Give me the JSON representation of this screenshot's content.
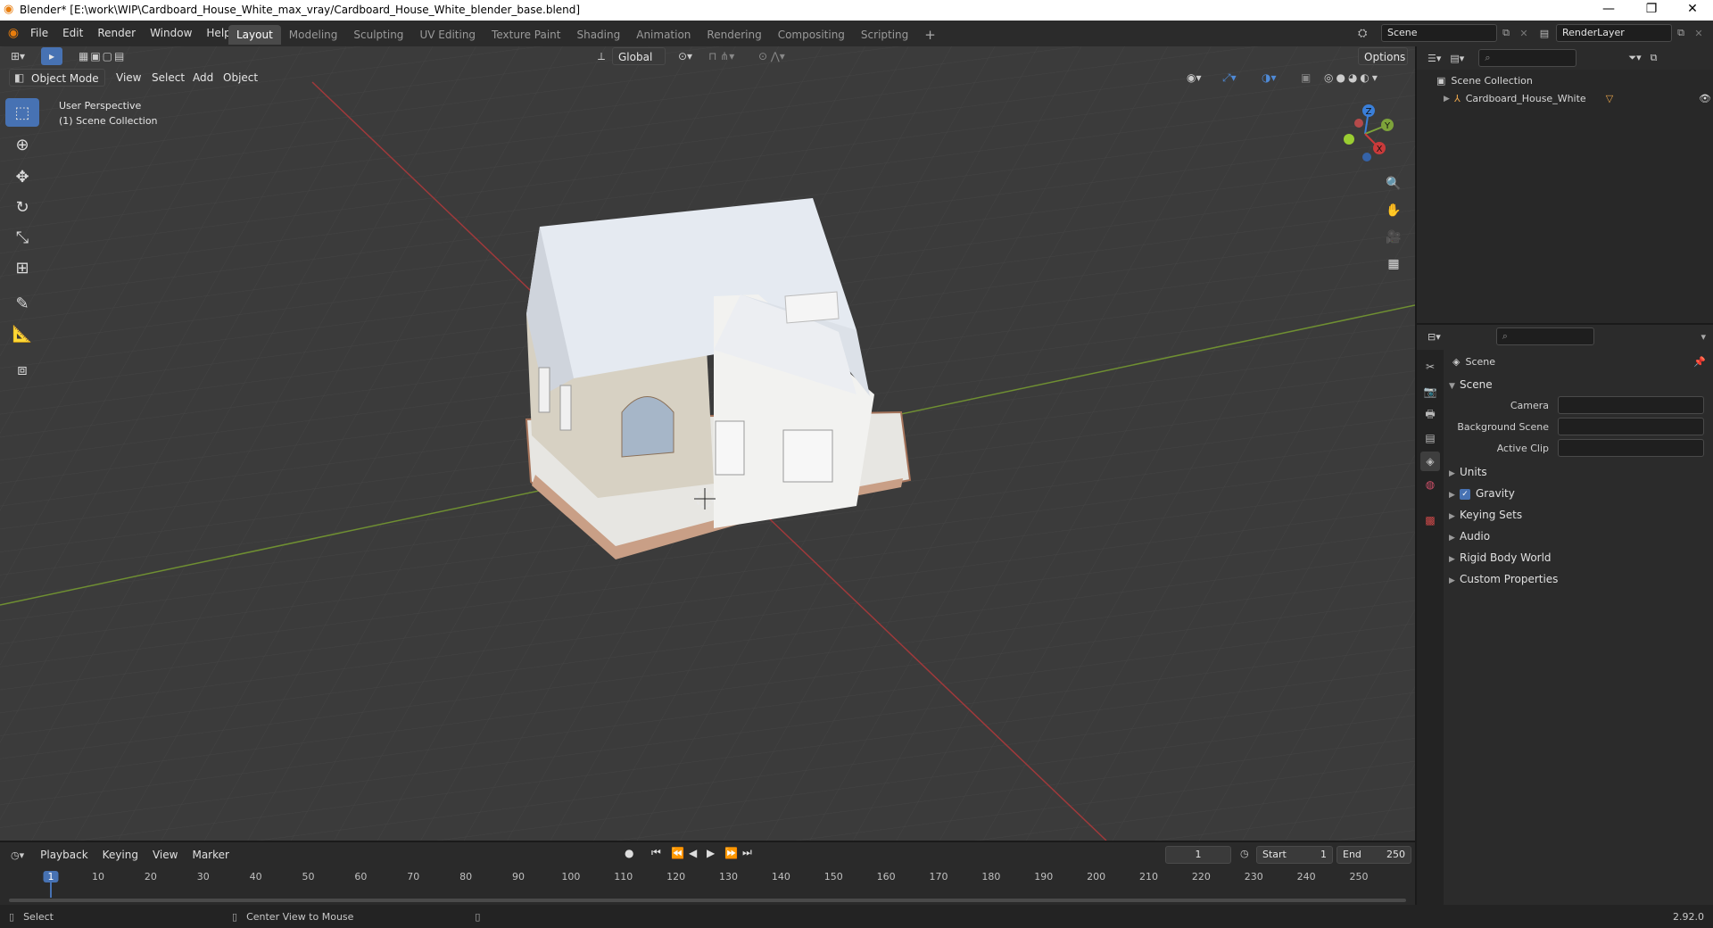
{
  "window": {
    "title": "Blender* [E:\\work\\WIP\\Cardboard_House_White_max_vray/Cardboard_House_White_blender_base.blend]",
    "minimize": "—",
    "maximize": "❐",
    "close": "✕"
  },
  "menu": [
    "File",
    "Edit",
    "Render",
    "Window",
    "Help"
  ],
  "workspaces": [
    "Layout",
    "Modeling",
    "Sculpting",
    "UV Editing",
    "Texture Paint",
    "Shading",
    "Animation",
    "Rendering",
    "Compositing",
    "Scripting"
  ],
  "scene_name": "Scene",
  "view_layer": "RenderLayer",
  "viewport": {
    "orientation": "Global",
    "options": "Options",
    "mode": "Object Mode",
    "menus": [
      "View",
      "Select",
      "Add",
      "Object"
    ],
    "perspective": "User Perspective",
    "collection_label": "(1) Scene Collection",
    "gizmo": {
      "z": "Z",
      "y": "Y",
      "x": "X"
    }
  },
  "outliner": {
    "root": "Scene Collection",
    "object": "Cardboard_House_White"
  },
  "properties": {
    "context": "Scene",
    "section": "Scene",
    "fields": [
      {
        "label": "Camera",
        "value": ""
      },
      {
        "label": "Background Scene",
        "value": ""
      },
      {
        "label": "Active Clip",
        "value": ""
      }
    ],
    "panels": [
      "Units",
      "Gravity",
      "Keying Sets",
      "Audio",
      "Rigid Body World",
      "Custom Properties"
    ],
    "gravity_checked": true
  },
  "timeline": {
    "menus": [
      "Playback",
      "Keying",
      "View",
      "Marker"
    ],
    "current_frame": "1",
    "start_label": "Start",
    "start": "1",
    "end_label": "End",
    "end": "250",
    "ticks": [
      "1",
      "10",
      "20",
      "30",
      "40",
      "50",
      "60",
      "70",
      "80",
      "90",
      "100",
      "110",
      "120",
      "130",
      "140",
      "150",
      "160",
      "170",
      "180",
      "190",
      "200",
      "210",
      "220",
      "230",
      "240",
      "250"
    ]
  },
  "status": {
    "left": "Select",
    "middle": "Center View to Mouse",
    "version": "2.92.0"
  },
  "colors": {
    "accent": "#4772b3",
    "x_axis": "#c93a3a",
    "y_axis": "#7da33a",
    "z_axis": "#3a7fd9"
  }
}
